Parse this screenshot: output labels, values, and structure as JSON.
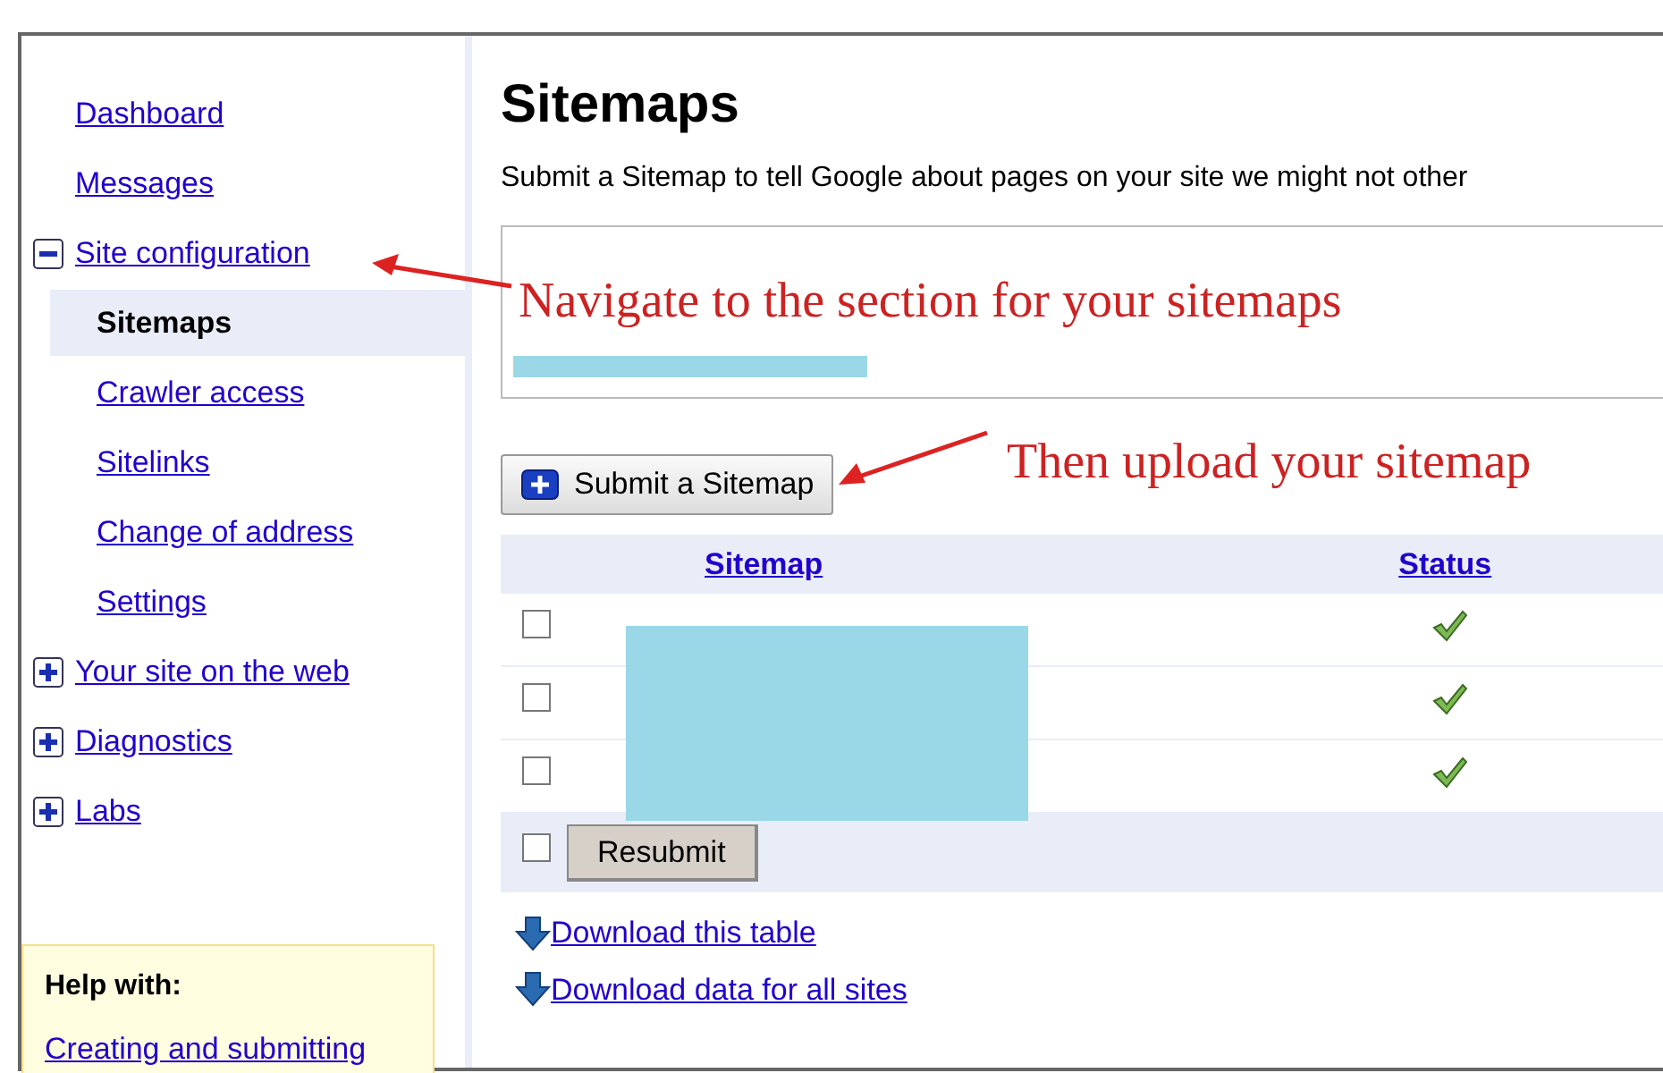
{
  "sidebar": {
    "items": [
      {
        "label": "Dashboard",
        "kind": "link"
      },
      {
        "label": "Messages",
        "kind": "link"
      },
      {
        "label": "Site configuration",
        "kind": "group",
        "expanded": true,
        "children": [
          {
            "label": "Sitemaps",
            "selected": true
          },
          {
            "label": "Crawler access",
            "selected": false
          },
          {
            "label": "Sitelinks",
            "selected": false
          },
          {
            "label": "Change of address",
            "selected": false
          },
          {
            "label": "Settings",
            "selected": false
          }
        ]
      },
      {
        "label": "Your site on the web",
        "kind": "group",
        "expanded": false
      },
      {
        "label": "Diagnostics",
        "kind": "group",
        "expanded": false
      },
      {
        "label": "Labs",
        "kind": "group",
        "expanded": false
      }
    ],
    "help": {
      "title": "Help with:",
      "link": "Creating and submitting"
    }
  },
  "main": {
    "title": "Sitemaps",
    "description": "Submit a Sitemap to tell Google about pages on your site we might not other",
    "submit_button": "Submit a Sitemap",
    "table": {
      "columns": [
        "Sitemap",
        "Status"
      ],
      "rows": [
        {
          "checked": false,
          "valid": true
        },
        {
          "checked": false,
          "valid": true
        },
        {
          "checked": false,
          "valid": true
        }
      ],
      "footer": {
        "checked": false,
        "button": "Resubmit"
      }
    },
    "links": [
      "Download this table",
      "Download data for all sites"
    ]
  },
  "annotations": [
    {
      "text": "Navigate to the section for your sitemaps"
    },
    {
      "text": "Then upload your sitemap"
    }
  ]
}
